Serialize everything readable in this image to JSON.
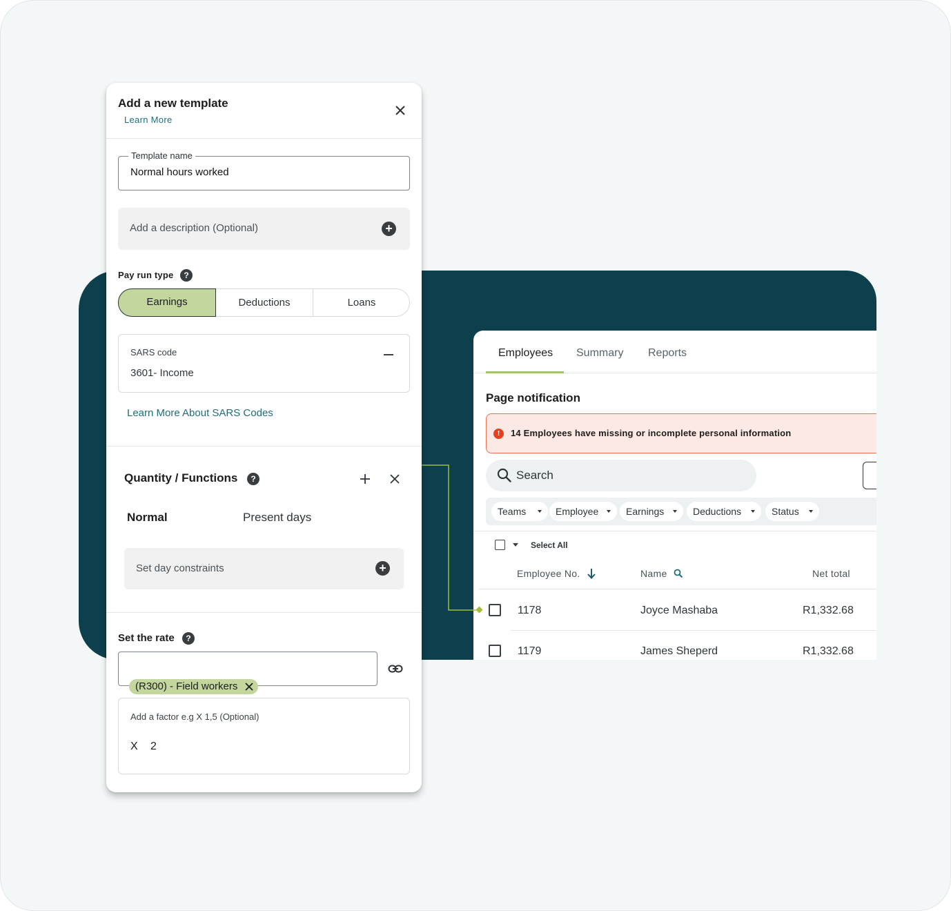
{
  "template_card": {
    "title": "Add a new template",
    "learn_more": "Learn More",
    "template_name": {
      "label": "Template name",
      "value": "Normal hours worked"
    },
    "description_placeholder": "Add a description (Optional)",
    "pay_run_type": {
      "label": "Pay run type",
      "help": "?",
      "options": [
        "Earnings",
        "Deductions",
        "Loans"
      ],
      "selected": "Earnings"
    },
    "sars_code": {
      "label": "SARS code",
      "value": "3601- Income"
    },
    "sars_link": "Learn More About SARS Codes",
    "quantity_functions": {
      "title": "Quantity / Functions",
      "help": "?",
      "left_label": "Normal",
      "right_label": "Present days",
      "constraints": "Set day constraints"
    },
    "rate": {
      "title": "Set the rate",
      "help": "?",
      "chip": "(R300) - Field workers",
      "factor_label": "Add a factor e.g X 1,5 (Optional)",
      "factor_prefix": "X",
      "factor_value": "2"
    }
  },
  "employees_panel": {
    "tabs": [
      "Employees",
      "Summary",
      "Reports"
    ],
    "active_tab": "Employees",
    "notification_title": "Page notification",
    "notification_icon": "!",
    "notification_text": "14 Employees have missing or incomplete personal information",
    "search_placeholder": "Search",
    "filters": [
      "Teams",
      "Employee",
      "Earnings",
      "Deductions",
      "Status"
    ],
    "select_all": "Select All",
    "columns": [
      "Employee No.",
      "Name",
      "Net total"
    ],
    "rows": [
      {
        "no": "1178",
        "name": "Joyce Mashaba",
        "net": "R1,332.68"
      },
      {
        "no": "1179",
        "name": "James Sheperd",
        "net": "R1,332.68"
      }
    ]
  },
  "colors": {
    "teal": "#0d3f4c",
    "accent_green": "#c2d69d",
    "link": "#1f6d7a",
    "alert_bg": "#fde9e3",
    "alert_border": "#e8734e",
    "connector": "#9fbf3b"
  },
  "icons": [
    "close-icon",
    "plus-circle-icon",
    "help-icon",
    "minus-icon",
    "plus-icon",
    "link-icon",
    "search-icon",
    "sort-down-icon",
    "caret-down-icon",
    "alert-icon"
  ]
}
